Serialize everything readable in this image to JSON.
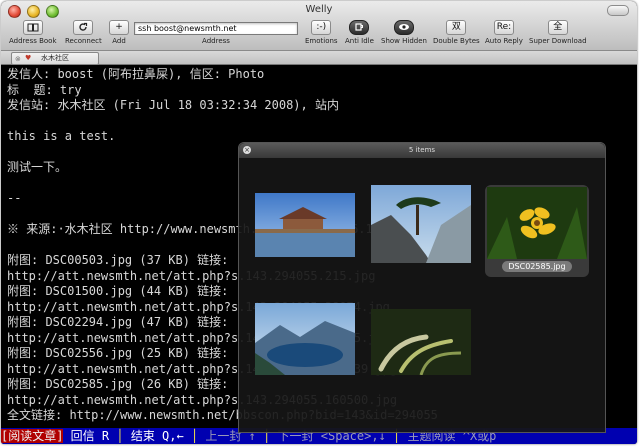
{
  "window": {
    "title": "Welly"
  },
  "toolbar": {
    "address_book": "Address Book",
    "reconnect": "Reconnect",
    "add": "Add",
    "address_value": "ssh boost@newsmth.net",
    "address_label": "Address",
    "emotions": "Emotions",
    "anti_idle": "Anti Idle",
    "show_hidden": "Show Hidden",
    "double_bytes": "Double Bytes",
    "auto_reply": "Auto Reply",
    "super_download": "Super Download",
    "btn_glyphs": {
      "emotions": ":-)",
      "double_bytes": "双",
      "auto_reply": "Re:",
      "super_download": "全"
    }
  },
  "tab": {
    "label": "水木社区"
  },
  "terminal": {
    "lines": [
      "发信人: boost (阿布拉鼻屎), 信区: Photo",
      "标  题: try",
      "发信站: 水木社区 (Fri Jul 18 03:32:34 2008), 站内",
      "",
      "this is a test.",
      "",
      "测试一下。",
      "",
      "--",
      "",
      "※ 来源:·水木社区 http://www.newsmth.net·[FROM: 216.146.47.*]",
      "",
      "附图: DSC00503.jpg (37 KB) 链接:",
      "http://att.newsmth.net/att.php?s.143.294055.215.jpg",
      "附图: DSC01500.jpg (44 KB) 链接:",
      "http://att.newsmth.net/att.php?s.143.294055.38074.jpg",
      "附图: DSC02294.jpg (47 KB) 链接:",
      "http://att.newsmth.net/att.php?s.143.294055.84045.jpg",
      "附图: DSC02556.jpg (25 KB) 链接:",
      "http://att.newsmth.net/att.php?s.143.294055.132339.jpg",
      "附图: DSC02585.jpg (26 KB) 链接:",
      "http://att.newsmth.net/att.php?s.143.294055.160500.jpg",
      "全文链接: http://www.newsmth.net/bbscon.php?bid=143&id=294055"
    ]
  },
  "status_bar": {
    "reading": "[阅读文章]",
    "reply": " 回信 R ",
    "sep1": "│",
    "end": " 结束 Q,← ",
    "sep2": "│",
    "prev": " 上一封 ↑ ",
    "sep3": "│",
    "next": " 下一封 <Space>,↓ ",
    "sep4": "│",
    "thread": " 主题阅读 ^X或p"
  },
  "preview": {
    "title": "5 items",
    "selected_caption": "DSC02585.jpg",
    "colors": {
      "selection": "#3a3a3a",
      "panel": "#161616"
    }
  }
}
